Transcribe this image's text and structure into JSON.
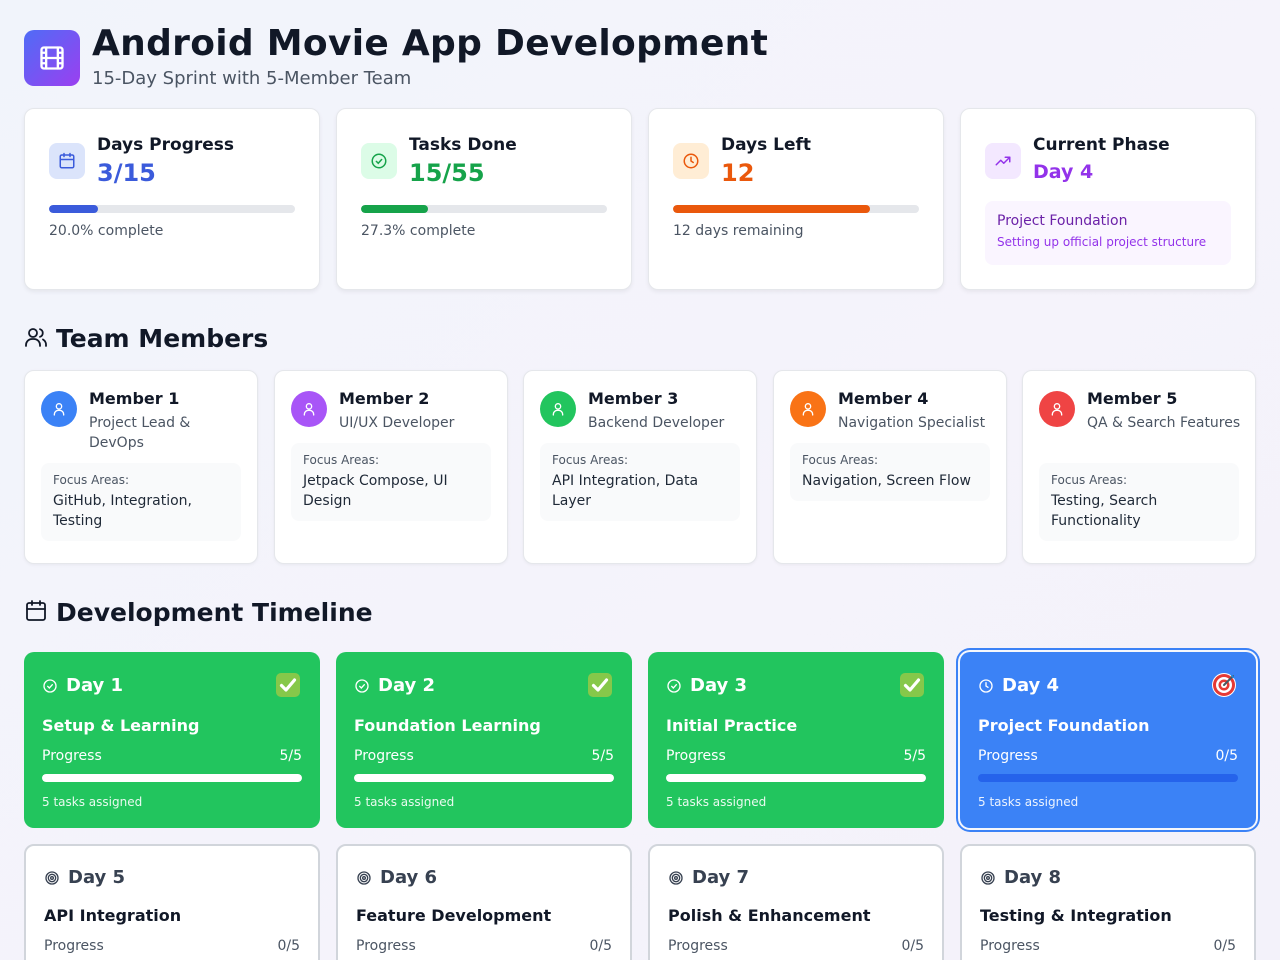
{
  "header": {
    "title": "Android Movie App Development",
    "subtitle": "15-Day Sprint with 5-Member Team",
    "logo_icon": "film-icon"
  },
  "stats": {
    "days_progress": {
      "label": "Days Progress",
      "value": "3/15",
      "percent": 20.0,
      "note": "20.0% complete",
      "color": "#3b5bdb",
      "icon": "calendar-icon"
    },
    "tasks_done": {
      "label": "Tasks Done",
      "value": "15/55",
      "percent": 27.3,
      "note": "27.3% complete",
      "color": "#16a34a",
      "icon": "check-circle-icon"
    },
    "days_left": {
      "label": "Days Left",
      "value": "12",
      "percent": 80.0,
      "note": "12 days remaining",
      "color": "#ea580c",
      "icon": "clock-icon"
    },
    "current_phase": {
      "label": "Current Phase",
      "value": "Day 4",
      "phase_title": "Project Foundation",
      "phase_desc": "Setting up official project structure",
      "color": "#9333ea",
      "icon": "trending-up-icon"
    }
  },
  "team": {
    "heading": "Team Members",
    "focus_label": "Focus Areas:",
    "members": [
      {
        "name": "Member 1",
        "role": "Project Lead & DevOps",
        "focus": "GitHub, Integration, Testing",
        "color": "#3b82f6"
      },
      {
        "name": "Member 2",
        "role": "UI/UX Developer",
        "focus": "Jetpack Compose, UI Design",
        "color": "#a855f7"
      },
      {
        "name": "Member 3",
        "role": "Backend Developer",
        "focus": "API Integration, Data Layer",
        "color": "#22c55e"
      },
      {
        "name": "Member 4",
        "role": "Navigation Specialist",
        "focus": "Navigation, Screen Flow",
        "color": "#f97316"
      },
      {
        "name": "Member 5",
        "role": "QA & Search Features",
        "focus": "Testing, Search Functionality",
        "color": "#ef4444"
      }
    ]
  },
  "timeline": {
    "heading": "Development Timeline",
    "progress_label": "Progress",
    "days": [
      {
        "day": "Day 1",
        "title": "Setup & Learning",
        "progress": "5/5",
        "fraction": 1.0,
        "tasks": "5 tasks assigned",
        "status": "done"
      },
      {
        "day": "Day 2",
        "title": "Foundation Learning",
        "progress": "5/5",
        "fraction": 1.0,
        "tasks": "5 tasks assigned",
        "status": "done"
      },
      {
        "day": "Day 3",
        "title": "Initial Practice",
        "progress": "5/5",
        "fraction": 1.0,
        "tasks": "5 tasks assigned",
        "status": "done"
      },
      {
        "day": "Day 4",
        "title": "Project Foundation",
        "progress": "0/5",
        "fraction": 0.0,
        "tasks": "5 tasks assigned",
        "status": "current"
      },
      {
        "day": "Day 5",
        "title": "API Integration",
        "progress": "0/5",
        "fraction": 0.0,
        "status": "future"
      },
      {
        "day": "Day 6",
        "title": "Feature Development",
        "progress": "0/5",
        "fraction": 0.0,
        "status": "future"
      },
      {
        "day": "Day 7",
        "title": "Polish & Enhancement",
        "progress": "0/5",
        "fraction": 0.0,
        "status": "future"
      },
      {
        "day": "Day 8",
        "title": "Testing & Integration",
        "progress": "0/5",
        "fraction": 0.0,
        "status": "future"
      }
    ]
  }
}
